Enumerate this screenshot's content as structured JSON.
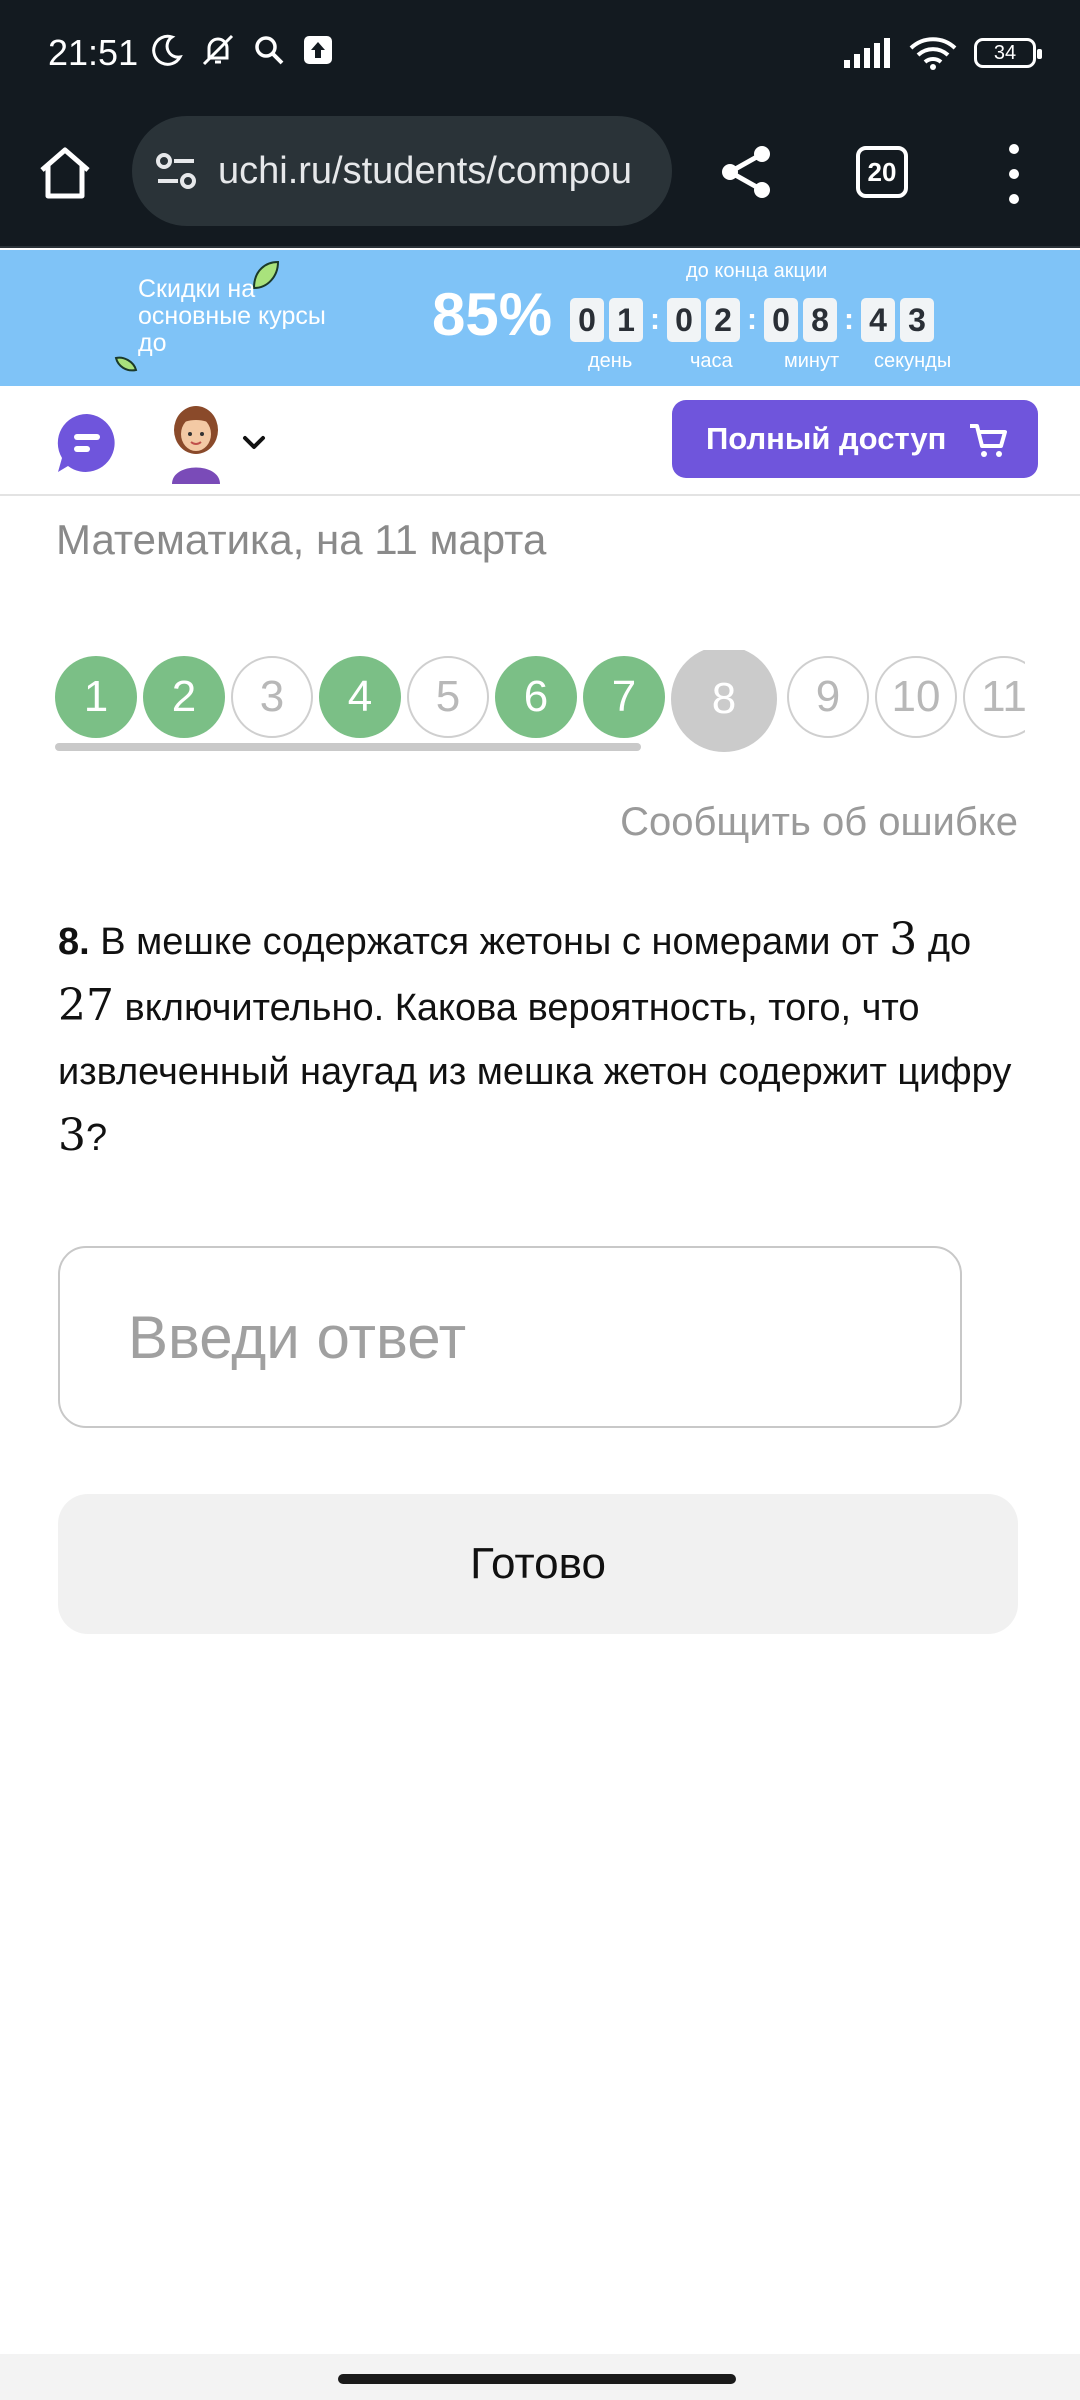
{
  "status_bar": {
    "time": "21:51",
    "battery": "34",
    "icons": [
      "moon-icon",
      "bell-off-icon",
      "search-icon",
      "upload-icon",
      "signal-icon",
      "wifi-icon",
      "battery-icon"
    ]
  },
  "browser": {
    "url": "uchi.ru/students/compou",
    "tab_count": "20",
    "icons": [
      "home-icon",
      "site-settings-icon",
      "share-icon",
      "tabs-icon",
      "more-vert-icon"
    ]
  },
  "promo": {
    "text": "Скидки на основные курсы до",
    "percent": "85%",
    "caption": "до конца акции",
    "timer": {
      "days": [
        "0",
        "1"
      ],
      "hours": [
        "0",
        "2"
      ],
      "minutes": [
        "0",
        "8"
      ],
      "seconds": [
        "4",
        "3"
      ],
      "labels": {
        "days": "день",
        "hours": "часа",
        "minutes": "минут",
        "seconds": "секунды"
      }
    }
  },
  "header": {
    "full_access": "Полный доступ"
  },
  "lesson": {
    "title": "Математика, на 11 марта",
    "steps": [
      {
        "label": "1",
        "state": "done"
      },
      {
        "label": "2",
        "state": "done"
      },
      {
        "label": "3",
        "state": "todo"
      },
      {
        "label": "4",
        "state": "done"
      },
      {
        "label": "5",
        "state": "todo"
      },
      {
        "label": "6",
        "state": "done"
      },
      {
        "label": "7",
        "state": "done"
      },
      {
        "label": "8",
        "state": "current"
      },
      {
        "label": "9",
        "state": "todo"
      },
      {
        "label": "10",
        "state": "todo"
      },
      {
        "label": "11",
        "state": "todo"
      }
    ],
    "report_error": "Сообщить об ошибке",
    "question": {
      "number": "8.",
      "part1": " В мешке содержатся жетоны с номерами от ",
      "num_a": "3",
      "part2": " до ",
      "num_b": "27",
      "part3": " включительно. Какова вероятность, того, что извлеченный наугад из мешка жетон содержит цифру ",
      "num_c": "3",
      "part4": "?"
    },
    "answer_placeholder": "Введи ответ",
    "submit": "Готово"
  },
  "colors": {
    "done": "#7bbf86",
    "current": "#cbcbcb",
    "accent": "#6f55dc",
    "promo": "#7fc3f7",
    "browser_bg": "#131a20"
  }
}
